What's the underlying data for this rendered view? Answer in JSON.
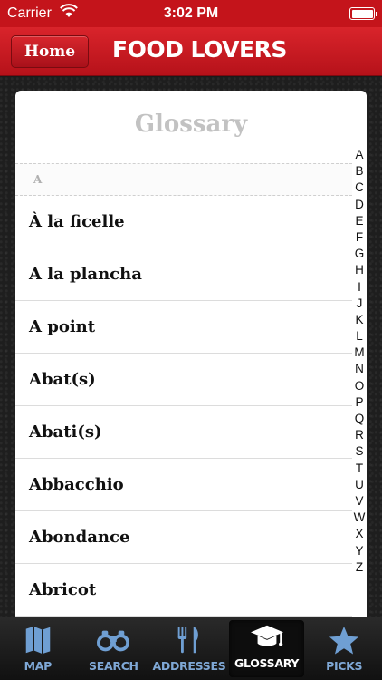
{
  "status_bar": {
    "carrier": "Carrier",
    "time": "3:02 PM",
    "battery_level": 1.0
  },
  "nav": {
    "home_label": "Home",
    "title": "FOOD LOVERS"
  },
  "glossary": {
    "title": "Glossary",
    "section": "A",
    "items": [
      "À la ficelle",
      "A la plancha",
      "A point",
      "Abat(s)",
      "Abati(s)",
      "Abbacchio",
      "Abondance",
      "Abricot"
    ],
    "index": [
      "A",
      "B",
      "C",
      "D",
      "E",
      "F",
      "G",
      "H",
      "I",
      "J",
      "K",
      "L",
      "M",
      "N",
      "O",
      "P",
      "Q",
      "R",
      "S",
      "T",
      "U",
      "V",
      "W",
      "X",
      "Y",
      "Z"
    ]
  },
  "tabs": [
    {
      "label": "MAP",
      "icon": "map-icon",
      "active": false
    },
    {
      "label": "SEARCH",
      "icon": "binoculars-icon",
      "active": false
    },
    {
      "label": "ADDRESSES",
      "icon": "cutlery-icon",
      "active": false
    },
    {
      "label": "GLOSSARY",
      "icon": "graduation-cap-icon",
      "active": true
    },
    {
      "label": "PICKS",
      "icon": "star-icon",
      "active": false
    }
  ],
  "colors": {
    "brand_red": "#c4141b",
    "tab_label": "#7fa8d6",
    "tab_icon": "#6f9fd3",
    "title_gray": "#c2c2c2"
  }
}
